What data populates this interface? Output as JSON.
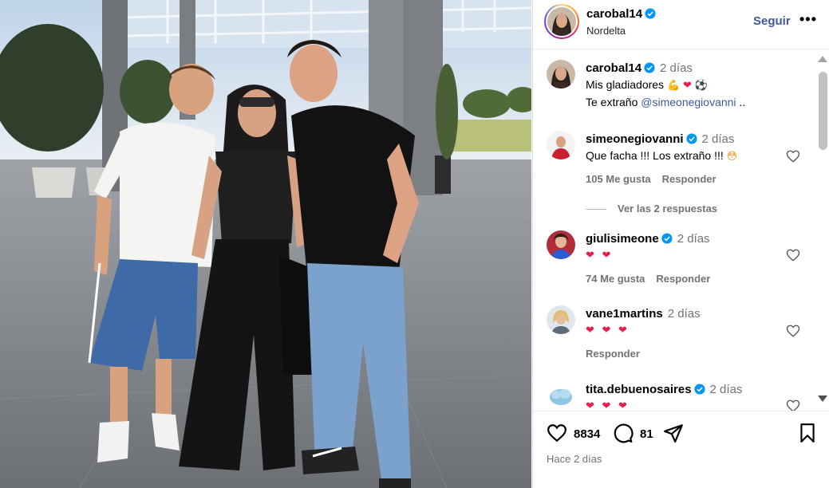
{
  "post": {
    "author": "carobal14",
    "location": "Nordelta",
    "follow_label": "Seguir",
    "more_label": "•••",
    "caption": {
      "user": "carobal14",
      "time": "2 días",
      "line1": "Mis gladiadores",
      "line2_prefix": "Te extraño ",
      "mention": "@simeonegiovanni",
      "line2_suffix": " .."
    }
  },
  "comments": [
    {
      "user": "simeonegiovanni",
      "verified": true,
      "time": "2 días",
      "text": "Que facha !!! Los extraño !!!",
      "likes": "105 Me gusta",
      "reply": "Responder"
    },
    {
      "user": "giulisimeone",
      "verified": true,
      "time": "2 días",
      "text": "❤ ❤",
      "likes": "74 Me gusta",
      "reply": "Responder"
    },
    {
      "user": "vane1martins",
      "verified": false,
      "time": "2 días",
      "text": "❤ ❤ ❤",
      "likes": "",
      "reply": "Responder"
    },
    {
      "user": "tita.debuenosaires",
      "verified": true,
      "time": "2 días",
      "text": "❤ ❤ ❤",
      "likes": "",
      "reply": ""
    }
  ],
  "view_replies": "Ver las 2 respuestas",
  "actions": {
    "likes": "8834",
    "comments": "81",
    "posted": "Hace 2 días"
  },
  "colors": {
    "link": "#3d5a9e",
    "verified": "#0095f6",
    "heart": "#e91e4f"
  }
}
